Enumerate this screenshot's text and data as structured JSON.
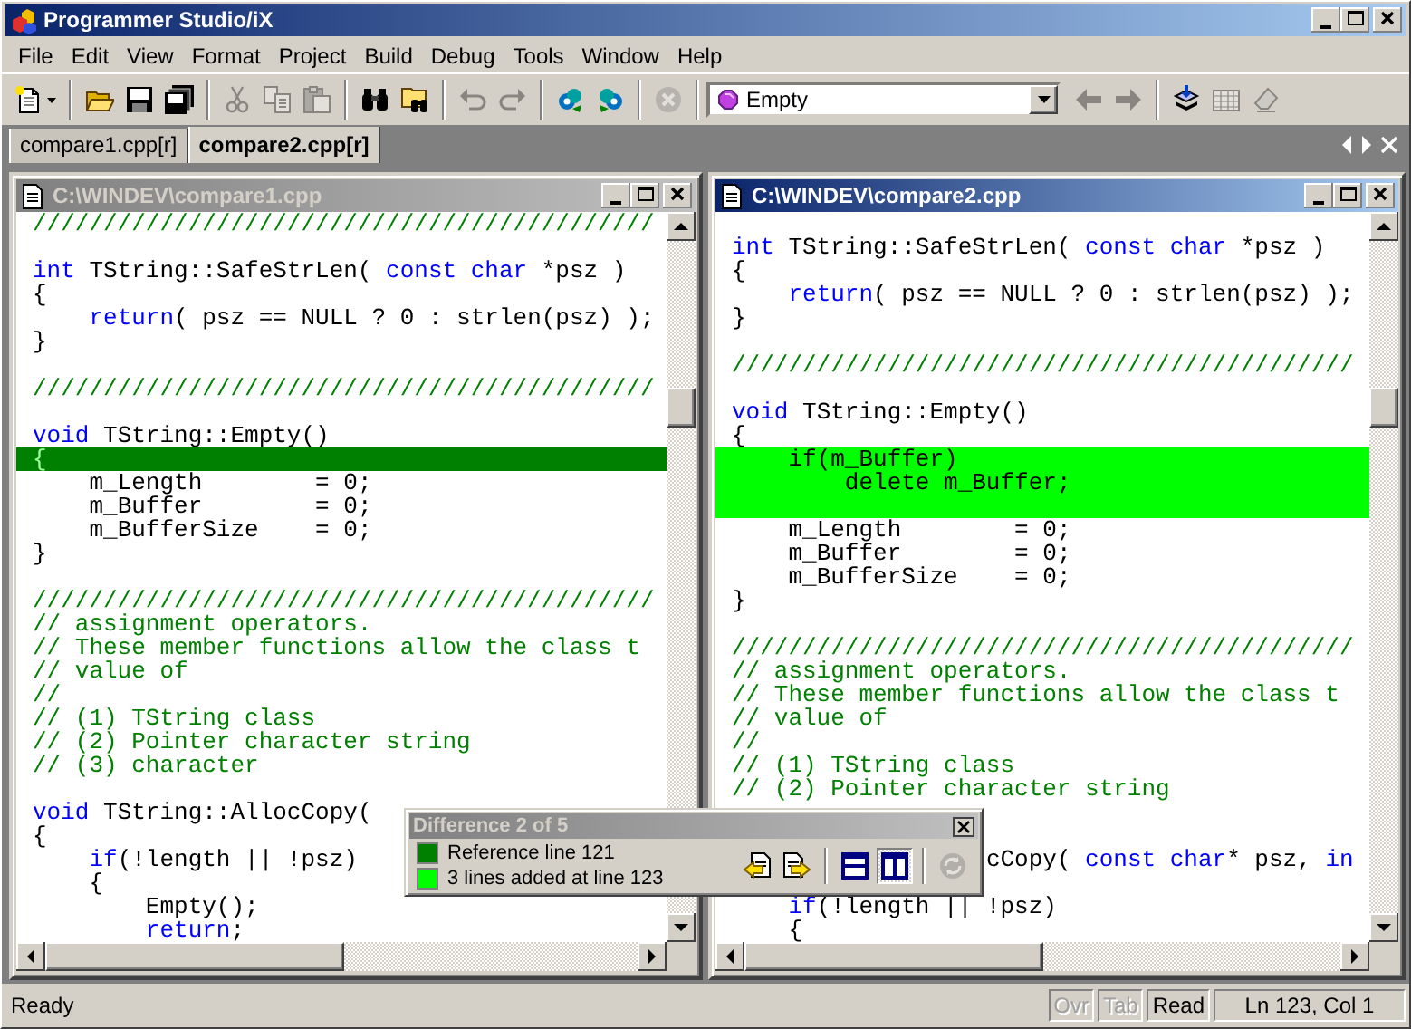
{
  "window": {
    "title": "Programmer Studio/iX"
  },
  "menu": [
    "File",
    "Edit",
    "View",
    "Format",
    "Project",
    "Build",
    "Debug",
    "Tools",
    "Window",
    "Help"
  ],
  "toolbar": [
    {
      "kind": "button",
      "disabled": false,
      "dropdown": true
    },
    {
      "kind": "separator"
    },
    {
      "kind": "button",
      "disabled": false
    },
    {
      "kind": "button",
      "disabled": false
    },
    {
      "kind": "button",
      "disabled": false
    },
    {
      "kind": "separator"
    },
    {
      "kind": "button",
      "disabled": true
    },
    {
      "kind": "button",
      "disabled": true
    },
    {
      "kind": "button",
      "disabled": true
    },
    {
      "kind": "separator"
    },
    {
      "kind": "button",
      "disabled": false
    },
    {
      "kind": "button",
      "disabled": false
    },
    {
      "kind": "separator"
    },
    {
      "kind": "button",
      "disabled": true
    },
    {
      "kind": "button",
      "disabled": true
    },
    {
      "kind": "separator"
    },
    {
      "kind": "button",
      "disabled": false
    },
    {
      "kind": "button",
      "disabled": false
    },
    {
      "kind": "separator"
    },
    {
      "kind": "button",
      "disabled": true
    },
    {
      "kind": "separator"
    },
    {
      "kind": "combo",
      "value": "Empty"
    },
    {
      "kind": "button",
      "disabled": true
    },
    {
      "kind": "button",
      "disabled": true
    },
    {
      "kind": "separator"
    },
    {
      "kind": "button",
      "disabled": false
    },
    {
      "kind": "button",
      "disabled": true
    },
    {
      "kind": "button",
      "disabled": true
    }
  ],
  "tabs": [
    {
      "label": "compare1.cpp[r]",
      "selected": false
    },
    {
      "label": "compare2.cpp[r]",
      "selected": true
    }
  ],
  "documents": [
    {
      "title": "C:\\WINDEV\\compare1.cpp",
      "active": false,
      "lines": [
        {
          "kind": "text",
          "segments": [
            {
              "kind": "comment",
              "text": "////////////////////////////////////////////"
            }
          ]
        },
        {
          "kind": "blank"
        },
        {
          "kind": "text",
          "segments": [
            {
              "kind": "keyword",
              "text": "int"
            },
            {
              "kind": "code",
              "text": " TString::SafeStrLen( "
            },
            {
              "kind": "keyword",
              "text": "const"
            },
            {
              "kind": "keyword",
              "text": " char"
            },
            {
              "kind": "code",
              "text": " *psz )"
            }
          ]
        },
        {
          "kind": "text",
          "segments": [
            {
              "kind": "code",
              "text": "{"
            }
          ]
        },
        {
          "kind": "text",
          "segments": [
            {
              "kind": "keyword",
              "text": "    return"
            },
            {
              "kind": "code",
              "text": "( psz == NULL ? 0 : strlen(psz) );"
            }
          ]
        },
        {
          "kind": "text",
          "segments": [
            {
              "kind": "code",
              "text": "}"
            }
          ]
        },
        {
          "kind": "blank"
        },
        {
          "kind": "text",
          "segments": [
            {
              "kind": "comment",
              "text": "////////////////////////////////////////////"
            }
          ]
        },
        {
          "kind": "blank"
        },
        {
          "kind": "text",
          "segments": [
            {
              "kind": "keyword",
              "text": "void"
            },
            {
              "kind": "code",
              "text": " TString::Empty()"
            }
          ]
        },
        {
          "kind": "text",
          "color": "#008000",
          "segments": [
            {
              "kind": "code",
              "text": "{"
            }
          ]
        },
        {
          "kind": "text",
          "segments": [
            {
              "kind": "code",
              "text": "    m_Length        = 0;"
            }
          ]
        },
        {
          "kind": "text",
          "segments": [
            {
              "kind": "code",
              "text": "    m_Buffer        = 0;"
            }
          ]
        },
        {
          "kind": "text",
          "segments": [
            {
              "kind": "code",
              "text": "    m_BufferSize    = 0;"
            }
          ]
        },
        {
          "kind": "text",
          "segments": [
            {
              "kind": "code",
              "text": "}"
            }
          ]
        },
        {
          "kind": "blank"
        },
        {
          "kind": "text",
          "segments": [
            {
              "kind": "comment",
              "text": "////////////////////////////////////////////"
            }
          ]
        },
        {
          "kind": "text",
          "segments": [
            {
              "kind": "comment",
              "text": "// assignment operators."
            }
          ]
        },
        {
          "kind": "text",
          "segments": [
            {
              "kind": "comment",
              "text": "// These member functions allow the class t"
            }
          ]
        },
        {
          "kind": "text",
          "segments": [
            {
              "kind": "comment",
              "text": "// value of"
            }
          ]
        },
        {
          "kind": "text",
          "segments": [
            {
              "kind": "comment",
              "text": "//"
            }
          ]
        },
        {
          "kind": "text",
          "segments": [
            {
              "kind": "comment",
              "text": "// (1) TString class"
            }
          ]
        },
        {
          "kind": "text",
          "segments": [
            {
              "kind": "comment",
              "text": "// (2) Pointer character string"
            }
          ]
        },
        {
          "kind": "text",
          "segments": [
            {
              "kind": "comment",
              "text": "// (3) character"
            }
          ]
        },
        {
          "kind": "blank"
        },
        {
          "kind": "text",
          "segments": [
            {
              "kind": "keyword",
              "text": "void"
            },
            {
              "kind": "code",
              "text": " TString::AllocCopy("
            }
          ]
        },
        {
          "kind": "text",
          "segments": [
            {
              "kind": "code",
              "text": "{"
            }
          ]
        },
        {
          "kind": "text",
          "segments": [
            {
              "kind": "keyword",
              "text": "    if"
            },
            {
              "kind": "code",
              "text": "(!length || !psz)"
            }
          ]
        },
        {
          "kind": "text",
          "segments": [
            {
              "kind": "code",
              "text": "    {"
            }
          ]
        },
        {
          "kind": "text",
          "segments": [
            {
              "kind": "code",
              "text": "        Empty();"
            }
          ]
        },
        {
          "kind": "text",
          "segments": [
            {
              "kind": "keyword",
              "text": "        return"
            },
            {
              "kind": "code",
              "text": ";"
            }
          ]
        }
      ]
    },
    {
      "title": "C:\\WINDEV\\compare2.cpp",
      "active": true,
      "lines": [
        {
          "kind": "blank"
        },
        {
          "kind": "text",
          "segments": [
            {
              "kind": "keyword",
              "text": "int"
            },
            {
              "kind": "code",
              "text": " TString::SafeStrLen( "
            },
            {
              "kind": "keyword",
              "text": "const"
            },
            {
              "kind": "keyword",
              "text": " char"
            },
            {
              "kind": "code",
              "text": " *psz )"
            }
          ]
        },
        {
          "kind": "text",
          "segments": [
            {
              "kind": "code",
              "text": "{"
            }
          ]
        },
        {
          "kind": "text",
          "segments": [
            {
              "kind": "keyword",
              "text": "    return"
            },
            {
              "kind": "code",
              "text": "( psz == NULL ? 0 : strlen(psz) );"
            }
          ]
        },
        {
          "kind": "text",
          "segments": [
            {
              "kind": "code",
              "text": "}"
            }
          ]
        },
        {
          "kind": "blank"
        },
        {
          "kind": "text",
          "segments": [
            {
              "kind": "comment",
              "text": "////////////////////////////////////////////"
            }
          ]
        },
        {
          "kind": "blank"
        },
        {
          "kind": "text",
          "segments": [
            {
              "kind": "keyword",
              "text": "void"
            },
            {
              "kind": "code",
              "text": " TString::Empty()"
            }
          ]
        },
        {
          "kind": "text",
          "segments": [
            {
              "kind": "code",
              "text": "{"
            }
          ]
        },
        {
          "kind": "text",
          "color": "#00ff00",
          "segments": [
            {
              "kind": "code",
              "text": "    if(m_Buffer)"
            }
          ]
        },
        {
          "kind": "text",
          "color": "#00ff00",
          "segments": [
            {
              "kind": "code",
              "text": "        delete m_Buffer;"
            }
          ]
        },
        {
          "kind": "blank",
          "color": "#00ff00"
        },
        {
          "kind": "text",
          "segments": [
            {
              "kind": "code",
              "text": "    m_Length        = 0;"
            }
          ]
        },
        {
          "kind": "text",
          "segments": [
            {
              "kind": "code",
              "text": "    m_Buffer        = 0;"
            }
          ]
        },
        {
          "kind": "text",
          "segments": [
            {
              "kind": "code",
              "text": "    m_BufferSize    = 0;"
            }
          ]
        },
        {
          "kind": "text",
          "segments": [
            {
              "kind": "code",
              "text": "}"
            }
          ]
        },
        {
          "kind": "blank"
        },
        {
          "kind": "text",
          "segments": [
            {
              "kind": "comment",
              "text": "////////////////////////////////////////////"
            }
          ]
        },
        {
          "kind": "text",
          "segments": [
            {
              "kind": "comment",
              "text": "// assignment operators."
            }
          ]
        },
        {
          "kind": "text",
          "segments": [
            {
              "kind": "comment",
              "text": "// These member functions allow the class t"
            }
          ]
        },
        {
          "kind": "text",
          "segments": [
            {
              "kind": "comment",
              "text": "// value of"
            }
          ]
        },
        {
          "kind": "text",
          "segments": [
            {
              "kind": "comment",
              "text": "//"
            }
          ]
        },
        {
          "kind": "text",
          "segments": [
            {
              "kind": "comment",
              "text": "// (1) TString class"
            }
          ]
        },
        {
          "kind": "text",
          "segments": [
            {
              "kind": "comment",
              "text": "// (2) Pointer character string"
            }
          ]
        },
        {
          "kind": "blank"
        },
        {
          "kind": "blank"
        },
        {
          "kind": "text",
          "segments": [
            {
              "kind": "code",
              "text": "                  cCopy( "
            },
            {
              "kind": "keyword",
              "text": "const"
            },
            {
              "kind": "keyword",
              "text": " char"
            },
            {
              "kind": "code",
              "text": "* psz, "
            },
            {
              "kind": "keyword",
              "text": "in"
            }
          ]
        },
        {
          "kind": "blank"
        },
        {
          "kind": "text",
          "segments": [
            {
              "kind": "keyword",
              "text": "    if"
            },
            {
              "kind": "code",
              "text": "(!length || !psz)"
            }
          ]
        },
        {
          "kind": "text",
          "segments": [
            {
              "kind": "code",
              "text": "    {"
            }
          ]
        }
      ]
    }
  ],
  "difference": {
    "title": "Difference 2 of 5",
    "legend": [
      {
        "label": "Reference line 121",
        "color": "#008000"
      },
      {
        "label": "3 lines added at line 123",
        "color": "#00ff00"
      }
    ],
    "tools": [
      {
        "kind": "button",
        "disabled": false
      },
      {
        "kind": "button",
        "disabled": false
      },
      {
        "kind": "separator"
      },
      {
        "kind": "toggle",
        "selected": false
      },
      {
        "kind": "toggle",
        "selected": true
      },
      {
        "kind": "separator"
      },
      {
        "kind": "button",
        "disabled": true
      }
    ]
  },
  "status_bar": {
    "message": "Ready",
    "panes": [
      {
        "text": "Ovr",
        "disabled": true
      },
      {
        "text": "Tab",
        "disabled": true
      },
      {
        "text": "Read",
        "disabled": false
      },
      {
        "text": "Ln 123, Col 1",
        "disabled": false
      }
    ]
  }
}
